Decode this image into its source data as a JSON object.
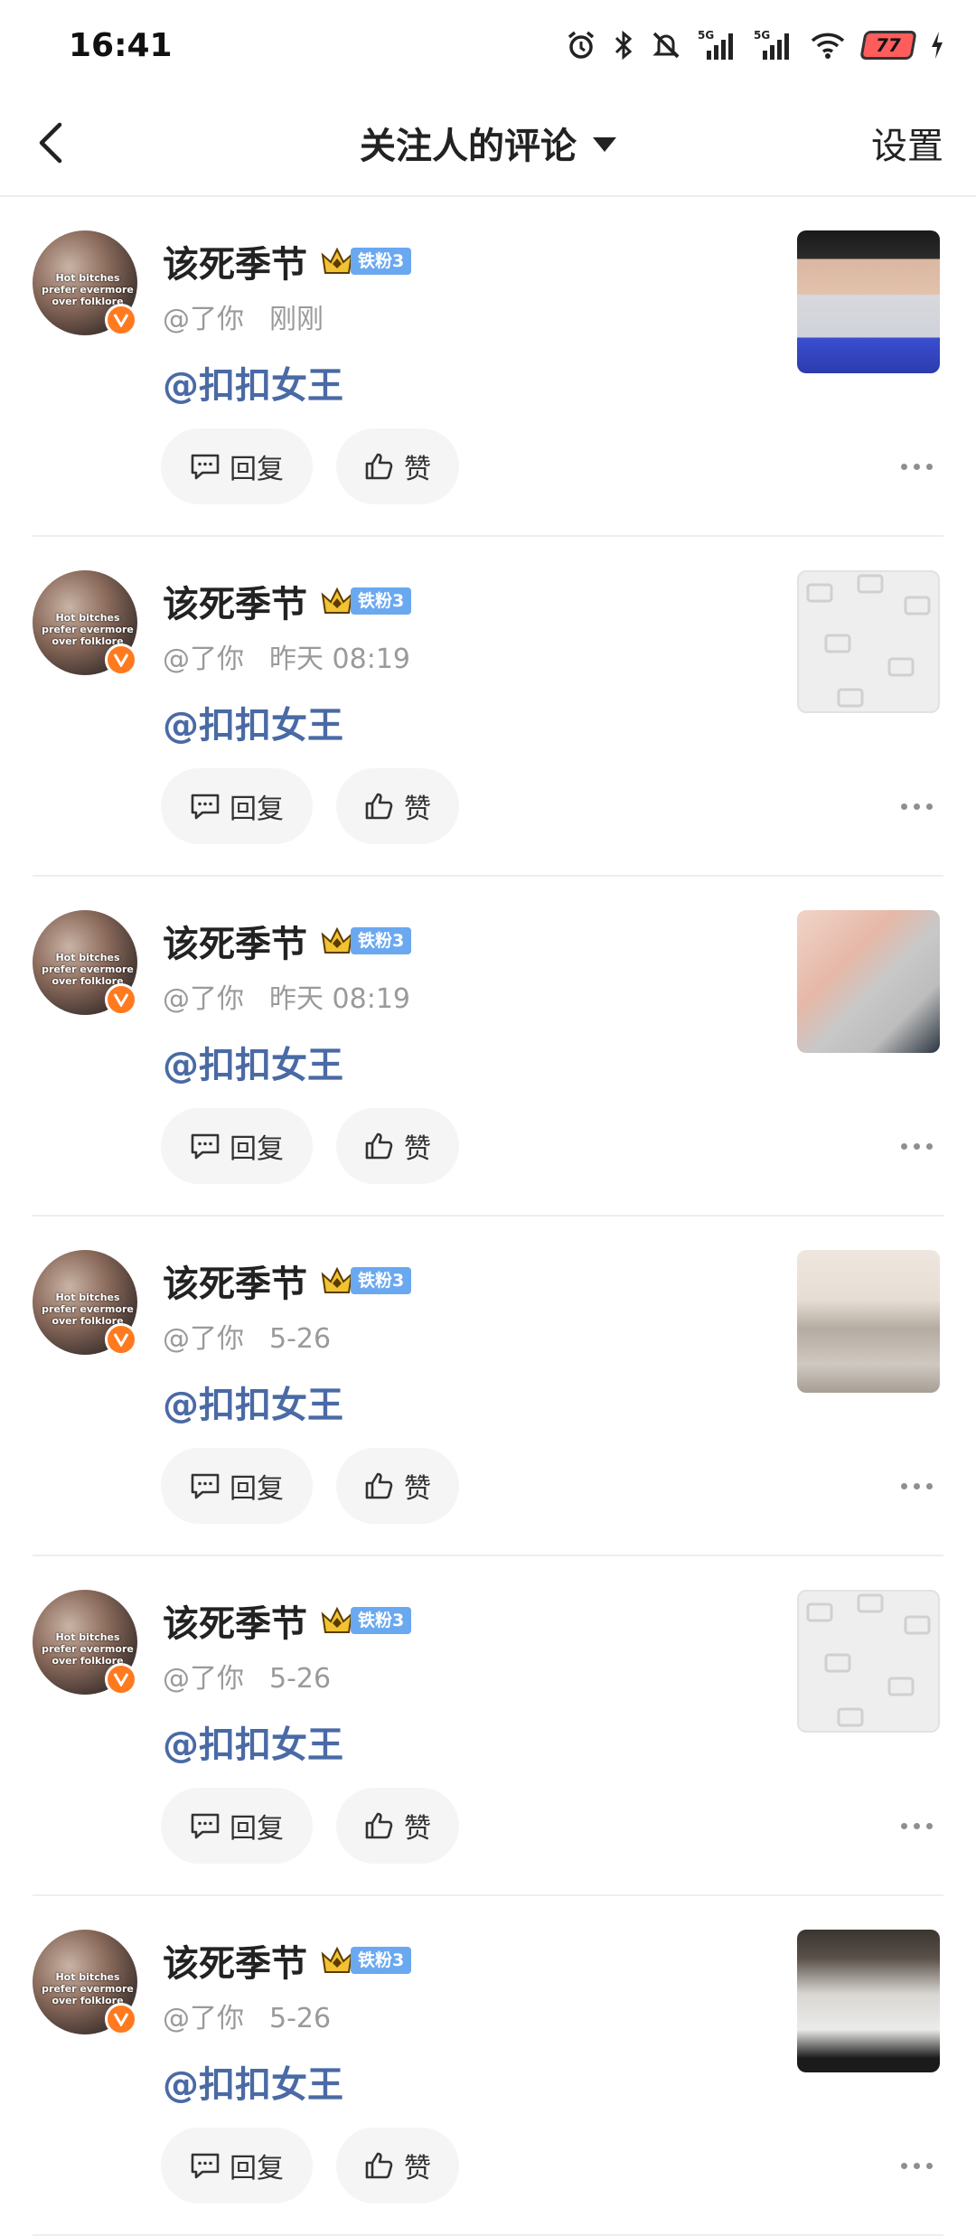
{
  "status_bar": {
    "time": "16:41",
    "battery": "77",
    "icons": [
      "alarm-icon",
      "bluetooth-icon",
      "mute-icon",
      "signal-5g-icon",
      "signal-5g-icon",
      "wifi-icon",
      "battery-icon",
      "charging-icon"
    ]
  },
  "nav": {
    "title": "关注人的评论",
    "settings_label": "设置"
  },
  "comments": [
    {
      "username": "该死季节",
      "fan_badge": "铁粉3",
      "handle": "@了你",
      "time": "刚刚",
      "mention": "@扣扣女王",
      "reply_label": "回复",
      "like_label": "赞",
      "thumbnail": "photo"
    },
    {
      "username": "该死季节",
      "fan_badge": "铁粉3",
      "handle": "@了你",
      "time": "昨天 08:19",
      "mention": "@扣扣女王",
      "reply_label": "回复",
      "like_label": "赞",
      "thumbnail": "placeholder"
    },
    {
      "username": "该死季节",
      "fan_badge": "铁粉3",
      "handle": "@了你",
      "time": "昨天 08:19",
      "mention": "@扣扣女王",
      "reply_label": "回复",
      "like_label": "赞",
      "thumbnail": "photo"
    },
    {
      "username": "该死季节",
      "fan_badge": "铁粉3",
      "handle": "@了你",
      "time": "5-26",
      "mention": "@扣扣女王",
      "reply_label": "回复",
      "like_label": "赞",
      "thumbnail": "photo"
    },
    {
      "username": "该死季节",
      "fan_badge": "铁粉3",
      "handle": "@了你",
      "time": "5-26",
      "mention": "@扣扣女王",
      "reply_label": "回复",
      "like_label": "赞",
      "thumbnail": "placeholder"
    },
    {
      "username": "该死季节",
      "fan_badge": "铁粉3",
      "handle": "@了你",
      "time": "5-26",
      "mention": "@扣扣女王",
      "reply_label": "回复",
      "like_label": "赞",
      "thumbnail": "photo"
    }
  ],
  "avatar_caption": "Hot bitches prefer evermore over folklore",
  "colors": {
    "mention": "#4a6aa5",
    "verified_badge": "#ff7a1f",
    "fan_badge": "#6aa8f0",
    "pill_bg": "#f5f5f5"
  }
}
